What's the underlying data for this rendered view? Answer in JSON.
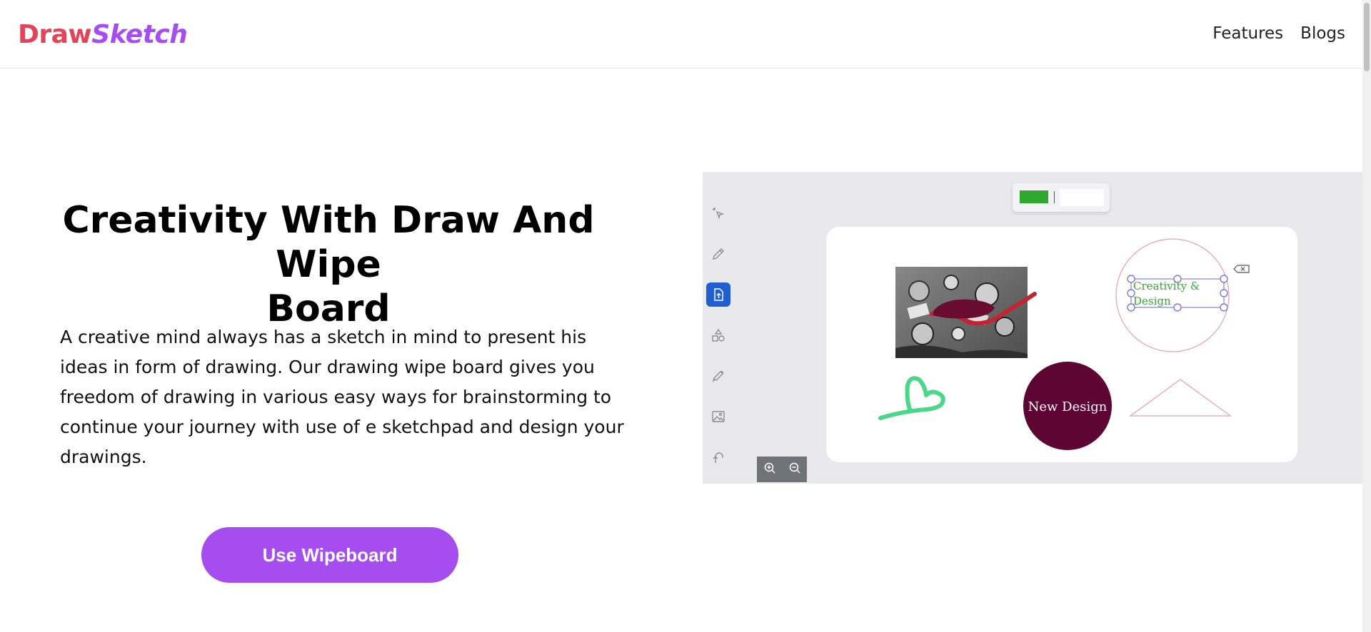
{
  "header": {
    "logo": {
      "part1": "Draw",
      "part2": "Sketch"
    },
    "nav": [
      {
        "label": "Features"
      },
      {
        "label": "Blogs"
      }
    ]
  },
  "hero": {
    "title_line1": "Creativity With Draw And Wipe",
    "title_line2": "Board",
    "description": "A creative mind always has a sketch in mind to present his ideas in form of drawing. Our drawing wipe board gives you freedom of drawing in various easy ways for brainstorming to continue your journey with use of e sketchpad and design your drawings.",
    "cta_label": "Use Wipeboard"
  },
  "preview": {
    "tools": [
      {
        "icon": "pointer-sparkle-icon",
        "active": false
      },
      {
        "icon": "pencil-icon",
        "active": false
      },
      {
        "icon": "file-upload-icon",
        "active": true
      },
      {
        "icon": "shapes-icon",
        "active": false
      },
      {
        "icon": "brush-icon",
        "active": false
      },
      {
        "icon": "image-icon",
        "active": false
      },
      {
        "icon": "undo-icon",
        "active": false
      }
    ],
    "stroke_color": "#2ea82e",
    "fill_color": "#ffffff",
    "canvas_text_box": {
      "line1": "Creativity &",
      "line2": "Design"
    },
    "circle_label": "New Design",
    "zoom": {
      "in": "zoom-in-icon",
      "out": "zoom-out-icon"
    }
  },
  "colors": {
    "accent": "#a64df0",
    "logo_red": "#e0455a",
    "tool_active": "#1f5fd1",
    "circle_fill": "#5e0633"
  }
}
